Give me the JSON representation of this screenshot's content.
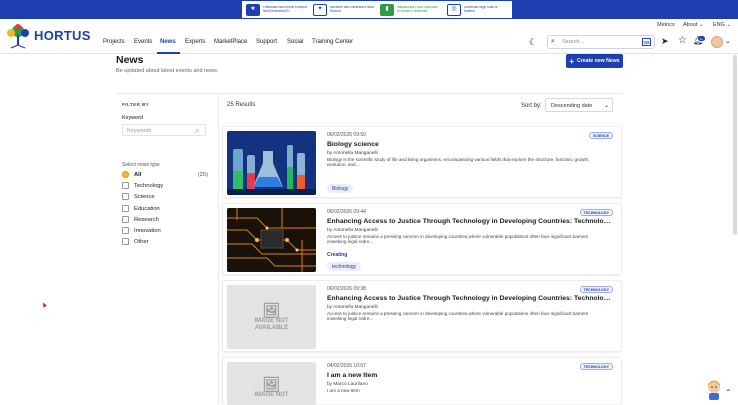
{
  "funding": [
    {
      "text": "Finanziato dall'Unione europea NextGenerationEU",
      "color": "#1d3fb0"
    },
    {
      "text": "Ministero dell'Università e della Ricerca",
      "color": "#1d3fb0"
    },
    {
      "text": "Italiadomani Piano nazionale di ripresa e resilienza",
      "color": "#2e9c47"
    },
    {
      "text": "Università degli Studi di Salerno",
      "color": "#1d3fb0"
    }
  ],
  "util": {
    "metrics": "Metrics",
    "about": "About",
    "lang": "ENG"
  },
  "brand": {
    "name": "HORTUS"
  },
  "nav": [
    "Projects",
    "Events",
    "News",
    "Experts",
    "MarketPlace",
    "Support",
    "Social",
    "Training Center"
  ],
  "search": {
    "placeholder": "Search..."
  },
  "notif": {
    "badge": "9+"
  },
  "page": {
    "title": "News",
    "subtitle": "Be updated about latest events and news.",
    "create_btn": "Create new News"
  },
  "filter": {
    "title": "FILTER BY",
    "keyword_label": "Keyword",
    "keyword_placeholder": "Keywords",
    "type_label": "Select news type",
    "types": [
      {
        "label": "All",
        "count": "(25)",
        "checked": true
      },
      {
        "label": "Technology",
        "count": "",
        "checked": false
      },
      {
        "label": "Science",
        "count": "",
        "checked": false
      },
      {
        "label": "Education",
        "count": "",
        "checked": false
      },
      {
        "label": "Research",
        "count": "",
        "checked": false
      },
      {
        "label": "Innovation",
        "count": "",
        "checked": false
      },
      {
        "label": "Other",
        "count": "",
        "checked": false
      }
    ]
  },
  "results": {
    "count_text": "25 Results",
    "sort_label": "Sort by:",
    "sort_value": "Descending date"
  },
  "cards": [
    {
      "date": "06/02/2026 09:50",
      "category": "SCIENCE",
      "title": "Biology science",
      "author": "by Antonella Manganelli",
      "excerpt": "Biology is the scientific study of life and living organisms, encompassing various fields that explore the structure, function, growth, evolution, and...",
      "link": "",
      "tag": "Biology",
      "image": "lab"
    },
    {
      "date": "06/02/2026 09:44",
      "category": "TECHNOLOGY",
      "title": "Enhancing Access to Justice Through Technology in Developing Countries: Technology-...",
      "author": "by Antonella Manganelli",
      "excerpt": "Access to justice remains a pressing concern in developing countries,where vulnerable populations often face significant barriers inseeking legal redre...",
      "link": "Creating",
      "tag": "technology",
      "image": "circuit"
    },
    {
      "date": "06/02/2026 09:38",
      "category": "TECHNOLOGY",
      "title": "Enhancing Access to Justice Through Technology in Developing Countries: Technology-...",
      "author": "by Antonella Manganelli",
      "excerpt": "Access to justice remains a pressing concern in developing countries,where vulnerable populations often face significant barriers inseeking legal redre...",
      "link": "",
      "tag": "",
      "image": "none",
      "noimg_text": "IMAGE NOT AVAILABLE"
    },
    {
      "date": "04/02/2026 10:07",
      "category": "TECHNOLOGY",
      "title": "I am a new Item",
      "author": "by Marco Laurilano",
      "excerpt": "I am a new Item",
      "link": "",
      "tag": "",
      "image": "none",
      "noimg_text": "IMAGE NOT"
    }
  ]
}
